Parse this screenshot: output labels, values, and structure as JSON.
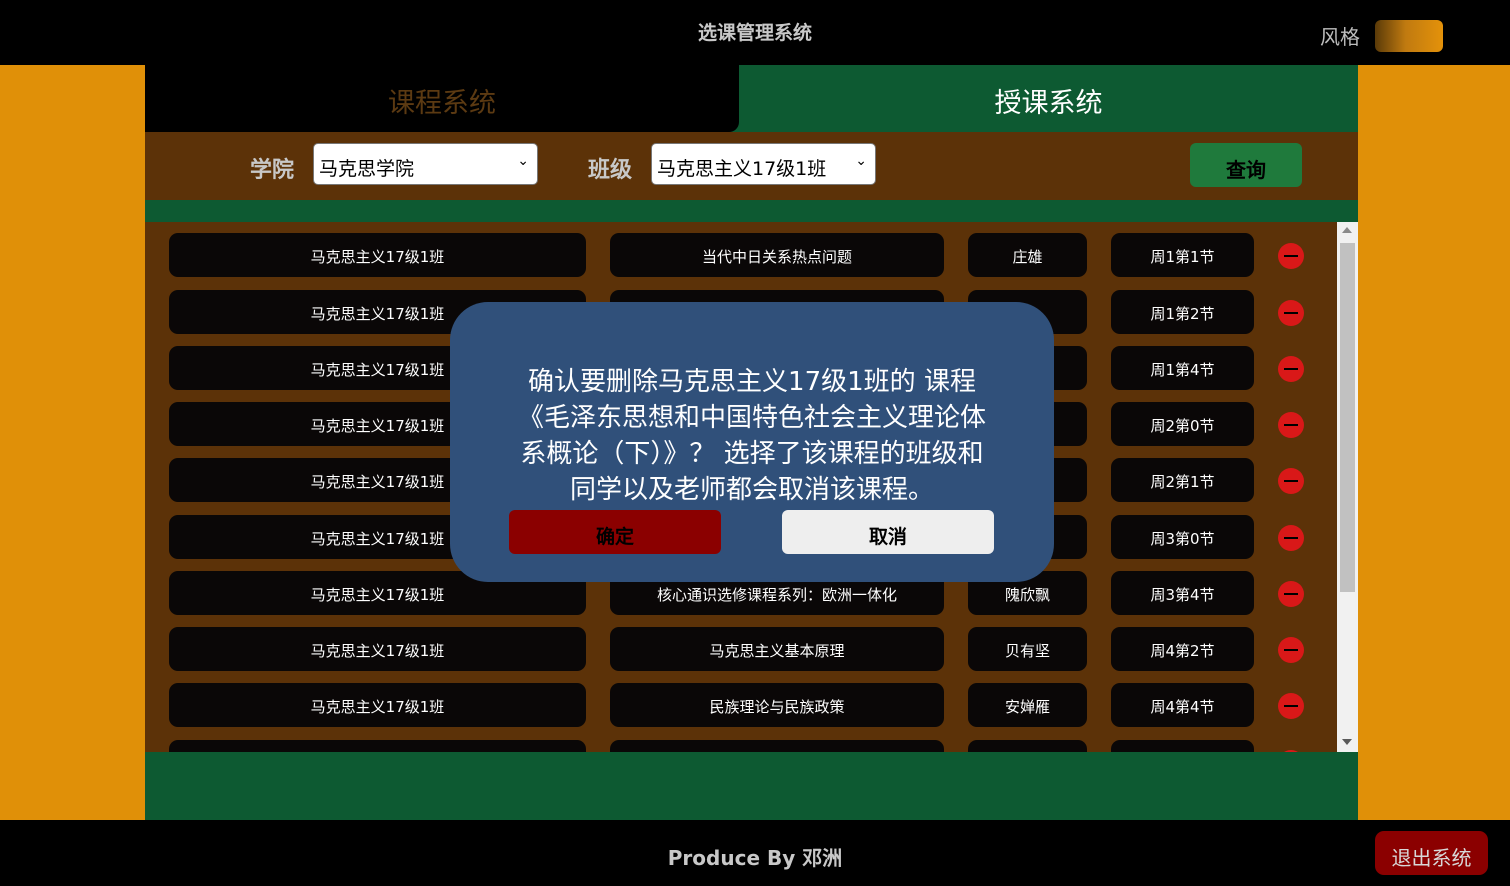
{
  "header": {
    "title": "选课管理系统",
    "style_label": "风格"
  },
  "tabs": {
    "course": "课程系统",
    "teaching": "授课系统",
    "active": "teaching"
  },
  "filter": {
    "college_label": "学院",
    "college_value": "马克思学院",
    "class_label": "班级",
    "class_value": "马克思主义17级1班",
    "query_label": "查询"
  },
  "rows": [
    {
      "class": "马克思主义17级1班",
      "course": "当代中日关系热点问题",
      "teacher": "庄雄",
      "time": "周1第1节"
    },
    {
      "class": "马克思主义17级1班",
      "course": "",
      "teacher": "",
      "time": "周1第2节"
    },
    {
      "class": "马克思主义17级1班",
      "course": "",
      "teacher": "",
      "time": "周1第4节"
    },
    {
      "class": "马克思主义17级1班",
      "course": "",
      "teacher": "",
      "time": "周2第0节"
    },
    {
      "class": "马克思主义17级1班",
      "course": "",
      "teacher": "",
      "time": "周2第1节"
    },
    {
      "class": "马克思主义17级1班",
      "course": "",
      "teacher": "",
      "time": "周3第0节"
    },
    {
      "class": "马克思主义17级1班",
      "course": "核心通识选修课程系列：欧洲一体化",
      "teacher": "隗欣飘",
      "time": "周3第4节"
    },
    {
      "class": "马克思主义17级1班",
      "course": "马克思主义基本原理",
      "teacher": "贝有坚",
      "time": "周4第2节"
    },
    {
      "class": "马克思主义17级1班",
      "course": "民族理论与民族政策",
      "teacher": "安婵雁",
      "time": "周4第4节"
    },
    {
      "class": "",
      "course": "",
      "teacher": "",
      "time": ""
    }
  ],
  "dialog": {
    "message": "确认要删除马克思主义17级1班的 课程《毛泽东思想和中国特色社会主义理论体系概论（下）》？ 选择了该课程的班级和同学以及老师都会取消该课程。",
    "confirm_label": "确定",
    "cancel_label": "取消"
  },
  "footer": {
    "credit": "Produce By 邓洲",
    "logout_label": "退出系统"
  },
  "colors": {
    "accent_orange": "#e09008",
    "panel_brown": "#5c3208",
    "main_green": "#0d5a32",
    "dialog_blue": "#30507a",
    "danger_red": "#8b0000",
    "delete_red": "#d91818"
  }
}
